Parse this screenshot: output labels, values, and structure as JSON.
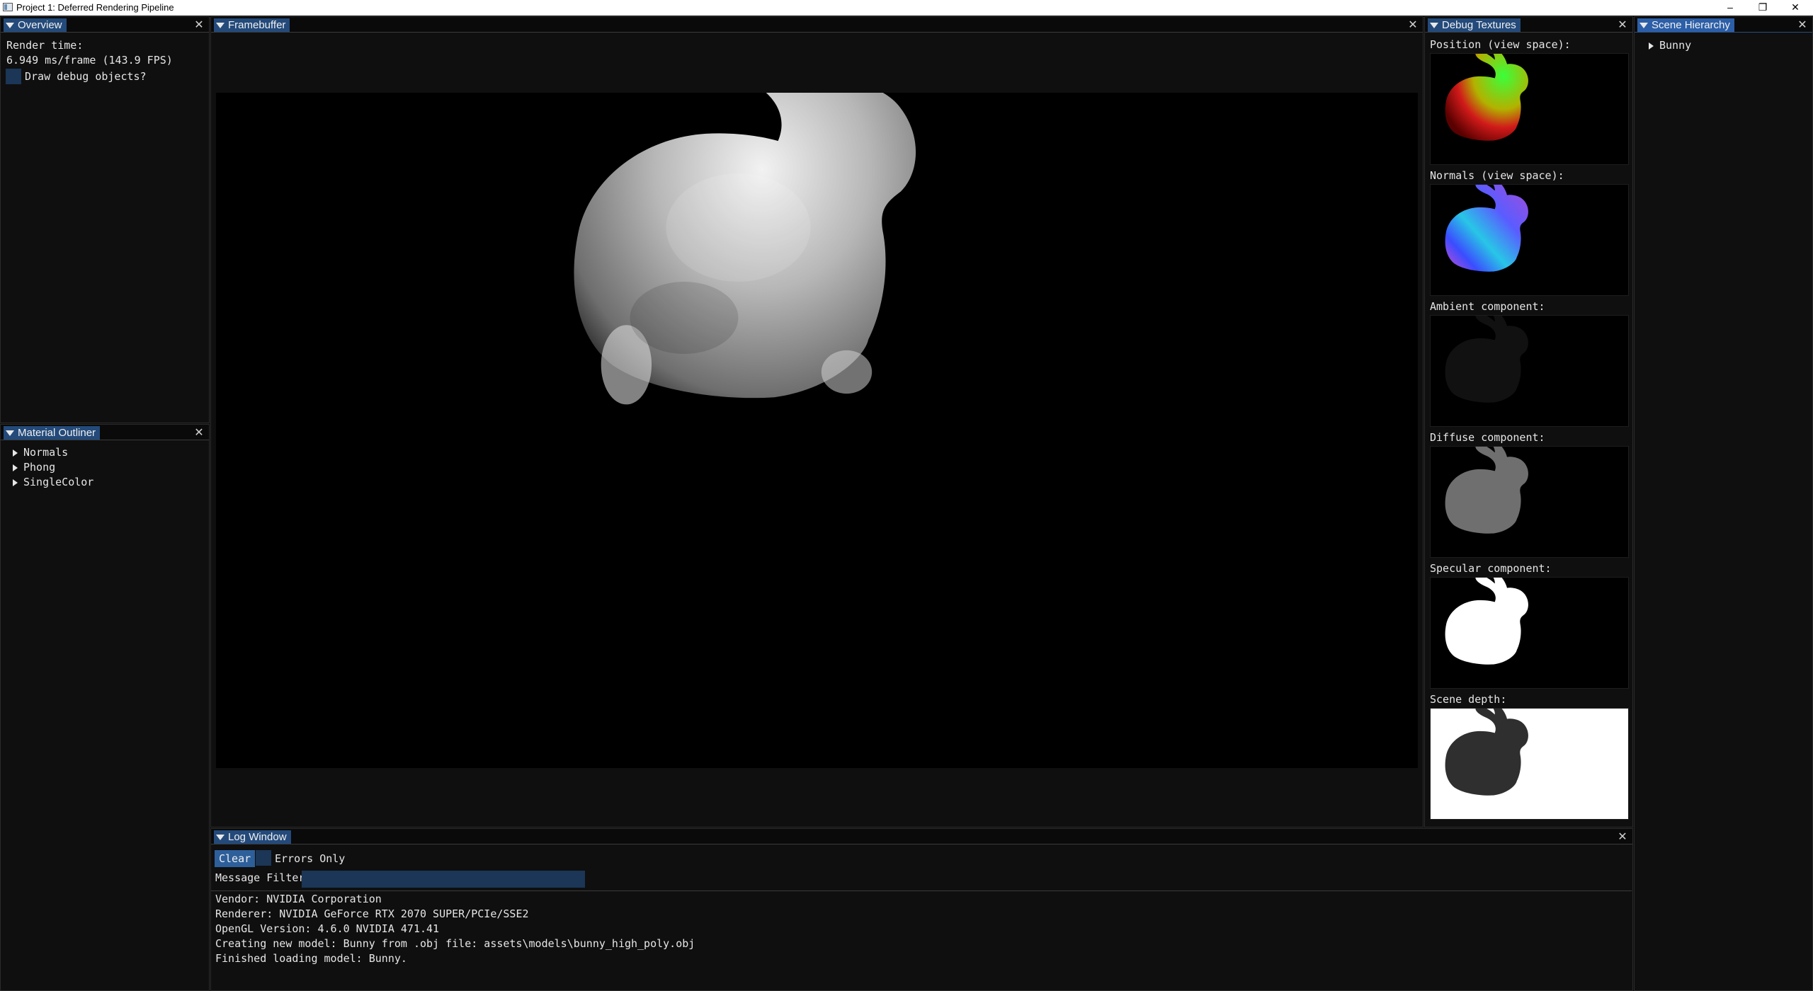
{
  "window": {
    "title": "Project 1: Deferred Rendering Pipeline",
    "controls": {
      "minimize": "–",
      "maximize": "❐",
      "close": "✕"
    }
  },
  "overview": {
    "tab": "Overview",
    "render_time_label": "Render time:",
    "render_time_value": "6.949 ms/frame (143.9 FPS)",
    "debug_objects_label": "Draw debug objects?",
    "debug_objects_checked": false
  },
  "material_outliner": {
    "tab": "Material Outliner",
    "items": [
      "Normals",
      "Phong",
      "SingleColor"
    ]
  },
  "framebuffer": {
    "tab": "Framebuffer"
  },
  "debug_textures": {
    "tab": "Debug Textures",
    "items": [
      {
        "label": "Position (view space):"
      },
      {
        "label": "Normals (view space):"
      },
      {
        "label": "Ambient component:"
      },
      {
        "label": "Diffuse component:"
      },
      {
        "label": "Specular component:"
      },
      {
        "label": "Scene depth:"
      }
    ]
  },
  "scene_hierarchy": {
    "tab": "Scene Hierarchy",
    "items": [
      "Bunny"
    ]
  },
  "log_window": {
    "tab": "Log Window",
    "clear_button": "Clear",
    "errors_only_label": "Errors Only",
    "message_filter_label": "Message Filter",
    "message_filter_value": "",
    "messages": [
      "Vendor: NVIDIA Corporation",
      "Renderer: NVIDIA GeForce RTX 2070 SUPER/PCIe/SSE2",
      "OpenGL Version: 4.6.0 NVIDIA 471.41",
      "Creating new model: Bunny from .obj file: assets\\models\\bunny_high_poly.obj",
      "Finished loading model: Bunny."
    ]
  },
  "colors": {
    "tab_active": "#234a7a",
    "tab_focused": "#2c5fa8",
    "background": "#0f0f0f",
    "frame_bg": "#1b3656"
  }
}
